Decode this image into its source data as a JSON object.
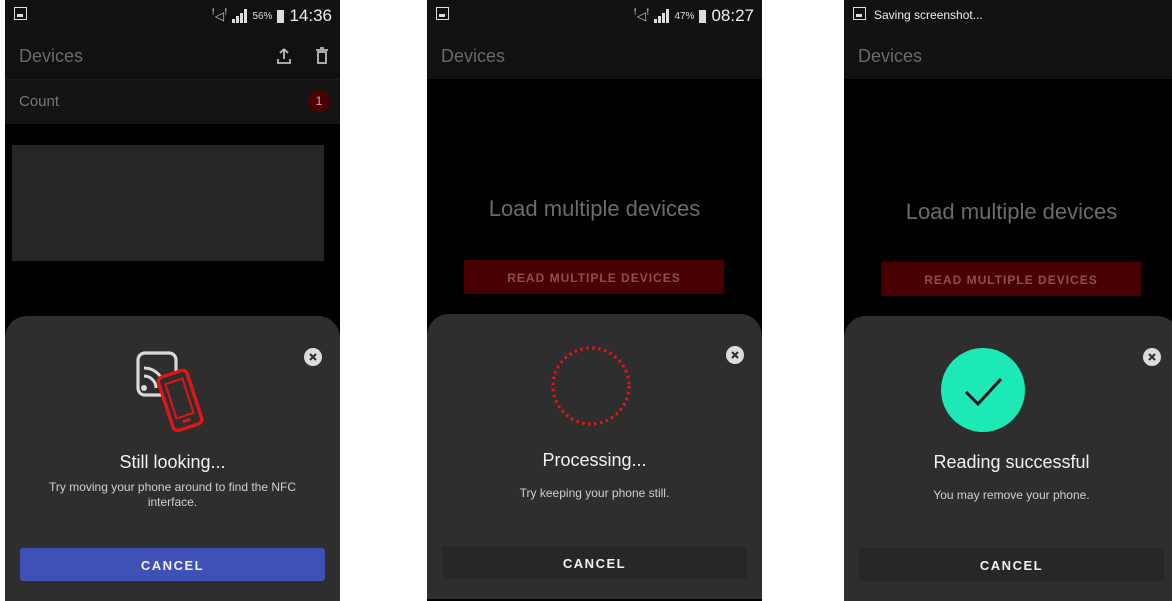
{
  "screens": [
    {
      "status": {
        "percent": "56%",
        "time": "14:36"
      },
      "appbar": {
        "title": "Devices"
      },
      "count": {
        "label": "Count",
        "badge": "1"
      },
      "sheet": {
        "title": "Still looking...",
        "message": "Try moving your phone around to find the NFC interface.",
        "cancel_label": "CANCEL",
        "graphic": "nfc-phone-icon"
      }
    },
    {
      "status": {
        "percent": "47%",
        "time": "08:27"
      },
      "appbar": {
        "title": "Devices"
      },
      "main": {
        "title": "Load multiple devices",
        "button_label": "READ MULTIPLE DEVICES"
      },
      "sheet": {
        "title": "Processing...",
        "message": "Try keeping your phone still.",
        "cancel_label": "CANCEL",
        "graphic": "progress-spinner-icon"
      }
    },
    {
      "status": {
        "notification": "Saving screenshot..."
      },
      "appbar": {
        "title": "Devices"
      },
      "main": {
        "title": "Load multiple devices",
        "button_label": "READ MULTIPLE DEVICES"
      },
      "sheet": {
        "title": "Reading successful",
        "message": "You may remove your phone.",
        "cancel_label": "CANCEL",
        "graphic": "checkmark-icon"
      }
    }
  ],
  "colors": {
    "accent_blue": "#3f51b5",
    "brand_red": "#d50000",
    "success_teal": "#1de9b6",
    "sheet_bg": "#2e2e2e"
  }
}
